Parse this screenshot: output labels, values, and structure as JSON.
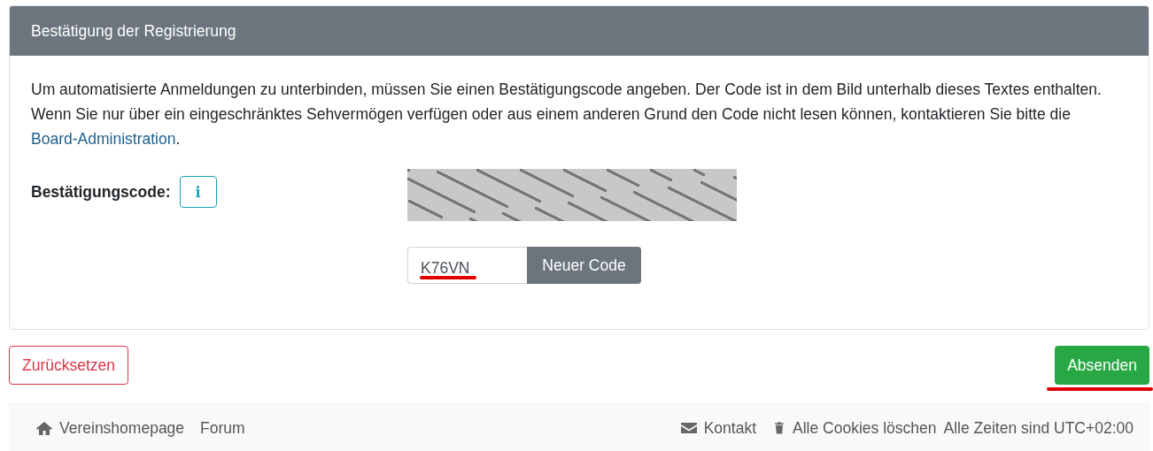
{
  "panel": {
    "title": "Bestätigung der Registrierung",
    "intro": {
      "text": "Um automatisierte Anmeldungen zu unterbinden, müssen Sie einen Bestätigungscode angeben. Der Code ist in dem Bild unterhalb dieses Textes enthalten. Wenn Sie nur über ein eingeschränktes Sehvermögen verfügen oder aus einem anderen Grund den Code nicht lesen können, kontaktieren Sie bitte die ",
      "link": "Board-Administration",
      "after": "."
    },
    "field": {
      "label": "Bestätigungscode:",
      "info_button": "i",
      "value": "K76VN",
      "new_code_button": "Neuer Code"
    }
  },
  "buttons": {
    "reset": "Zurücksetzen",
    "submit": "Absenden"
  },
  "footer": {
    "left": [
      {
        "kind": "home",
        "label": "Vereinshomepage"
      },
      {
        "kind": "plain",
        "label": "Forum"
      }
    ],
    "right": [
      {
        "kind": "mail",
        "label": "Kontakt"
      },
      {
        "kind": "trash",
        "label": "Alle Cookies löschen"
      }
    ],
    "timezone": "Alle Zeiten sind UTC+02:00"
  }
}
